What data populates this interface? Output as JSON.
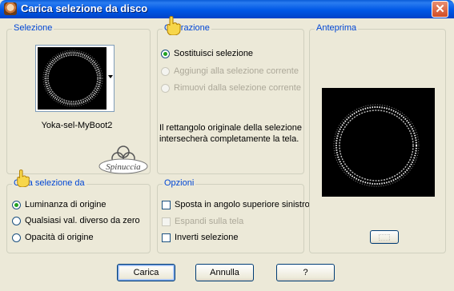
{
  "window": {
    "title": "Carica selezione da disco",
    "close_glyph": "✕"
  },
  "selezione": {
    "label": "Selezione",
    "file_name": "Yoka-sel-MyBoot2"
  },
  "operazione": {
    "label": "Operazione",
    "options": [
      {
        "label": "Sostituisci selezione",
        "selected": true,
        "enabled": true
      },
      {
        "label": "Aggiungi alla selezione corrente",
        "selected": false,
        "enabled": false
      },
      {
        "label": "Rimuovi dalla selezione corrente",
        "selected": false,
        "enabled": false
      }
    ],
    "description": "Il rettangolo originale della selezione intersecherà completamente la tela."
  },
  "crea_selezione": {
    "label": "Crea selezione da",
    "options": [
      {
        "label": "Luminanza di origine",
        "selected": true
      },
      {
        "label": "Qualsiasi val. diverso da zero",
        "selected": false
      },
      {
        "label": "Opacità di origine",
        "selected": false
      }
    ]
  },
  "opzioni": {
    "label": "Opzioni",
    "options": [
      {
        "label": "Sposta in angolo superiore sinistro",
        "checked": false,
        "enabled": true
      },
      {
        "label": "Espandi sulla tela",
        "checked": false,
        "enabled": false
      },
      {
        "label": "Inverti selezione",
        "checked": false,
        "enabled": true
      }
    ]
  },
  "anteprima": {
    "label": "Anteprima"
  },
  "watermark": "Spinuccia",
  "buttons": {
    "ok": "Carica",
    "cancel": "Annulla",
    "help": "?"
  }
}
